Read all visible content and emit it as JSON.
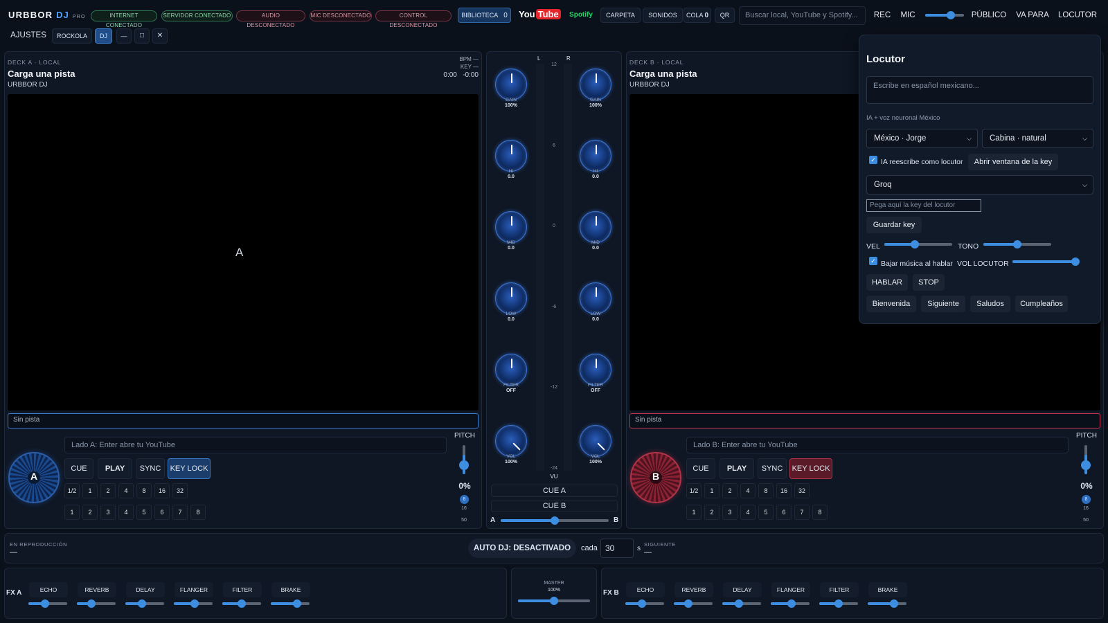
{
  "app": {
    "logo_main": "URBBOR",
    "logo_dj": "DJ",
    "logo_pro": "PRO"
  },
  "status": [
    {
      "label": "INTERNET CONECTADO",
      "state": "ok"
    },
    {
      "label": "SERVIDOR CONECTADO",
      "state": "ok"
    },
    {
      "label": "AUDIO DESCONECTADO",
      "state": "bad"
    },
    {
      "label": "MIC DESCONECTADO",
      "state": "bad"
    },
    {
      "label": "CONTROL DESCONECTADO",
      "state": "bad"
    }
  ],
  "topbar": {
    "biblioteca": "BIBLIOTECA",
    "biblioteca_count": "0",
    "youtube_you": "You",
    "youtube_tube": "Tube",
    "spotify": "Spotify",
    "carpeta": "CARPETA",
    "sonidos": "SONIDOS",
    "cola": "COLA",
    "cola_count": "0",
    "qr": "QR",
    "search_placeholder": "Buscar local, YouTube y Spotify...",
    "rec": "REC",
    "mic": "MIC",
    "mic_level": 0.65,
    "publico": "PÚBLICO",
    "vapara": "VA PARA",
    "locutor": "LOCUTOR"
  },
  "secondbar": {
    "ajustes": "AJUSTES",
    "rockola": "ROCKOLA",
    "dj": "DJ",
    "minimize": "—",
    "maximize": "□",
    "close": "✕"
  },
  "deckA": {
    "label": "DECK A · LOCAL",
    "title": "Carga una pista",
    "sub": "URBBOR DJ",
    "bpm": "BPM —",
    "key": "KEY —",
    "time": "0:00   -0:00",
    "wave_letter": "A",
    "track": "Sin pista",
    "search_placeholder": "Lado A: Enter abre tu YouTube",
    "jog": "A",
    "cue": "CUE",
    "play": "PLAY",
    "sync": "SYNC",
    "keylock": "KEY LOCK",
    "loops": [
      "1/2",
      "1",
      "2",
      "4",
      "8",
      "16",
      "32"
    ],
    "hotcues": [
      "1",
      "2",
      "3",
      "4",
      "5",
      "6",
      "7",
      "8"
    ],
    "pitch_label": "PITCH",
    "pitch": "0%",
    "ranges": [
      "8",
      "16",
      "50"
    ]
  },
  "deckB": {
    "label": "DECK B · LOCAL",
    "title": "Carga una pista",
    "sub": "URBBOR DJ",
    "track": "Sin pista",
    "search_placeholder": "Lado B: Enter abre tu YouTube",
    "jog": "B",
    "cue": "CUE",
    "play": "PLAY",
    "sync": "SYNC",
    "keylock": "KEY LOCK",
    "loops": [
      "1/2",
      "1",
      "2",
      "4",
      "8",
      "16",
      "32"
    ],
    "hotcues": [
      "1",
      "2",
      "3",
      "4",
      "5",
      "6",
      "7",
      "8"
    ],
    "pitch_label": "PITCH",
    "pitch": "0%",
    "ranges": [
      "8",
      "16",
      "50"
    ]
  },
  "mixer": {
    "L": "L",
    "R": "R",
    "vu": "VU",
    "scale": [
      "12",
      "6",
      "0",
      "-6",
      "-12",
      "-24"
    ],
    "knobs": [
      {
        "name": "GAIN",
        "value": "100%"
      },
      {
        "name": "HI",
        "value": "0.0"
      },
      {
        "name": "MID",
        "value": "0.0"
      },
      {
        "name": "LOW",
        "value": "0.0"
      },
      {
        "name": "FILTER",
        "value": "OFF"
      },
      {
        "name": "VOL",
        "value": "100%"
      }
    ],
    "cueA": "CUE A",
    "cueB": "CUE B",
    "xA": "A",
    "xB": "B",
    "crossfader": 0.5
  },
  "locutor": {
    "title": "Locutor",
    "textarea_placeholder": "Escribe en español mexicano...",
    "note": "IA + voz neuronal México",
    "voice": "México · Jorge",
    "style": "Cabina · natural",
    "ia_rewrite": "IA reescribe como locutor",
    "open_key": "Abrir ventana de la key",
    "provider": "Groq",
    "key_placeholder": "Pega aquí la key del locutor",
    "save_key": "Guardar key",
    "vel": "VEL",
    "vel_level": 0.45,
    "tono": "TONO",
    "tono_level": 0.5,
    "bajar": "Bajar música al hablar",
    "vol_locutor": "VOL LOCUTOR",
    "vol_level": 0.95,
    "hablar": "HABLAR",
    "stop": "STOP",
    "presets": [
      "Bienvenida",
      "Siguiente",
      "Saludos",
      "Cumpleaños"
    ]
  },
  "autodj": {
    "now_label": "EN REPRODUCCIÓN",
    "now": "—",
    "button": "AUTO DJ: DESACTIVADO",
    "cada": "cada",
    "seconds": "30",
    "s": "s",
    "next_label": "SIGUIENTE",
    "next": "—"
  },
  "fx": {
    "a_label": "FX A",
    "b_label": "FX B",
    "effects": [
      "ECHO",
      "REVERB",
      "DELAY",
      "FLANGER",
      "FILTER",
      "BRAKE"
    ],
    "master_label": "MASTER",
    "master_value": "100%"
  }
}
